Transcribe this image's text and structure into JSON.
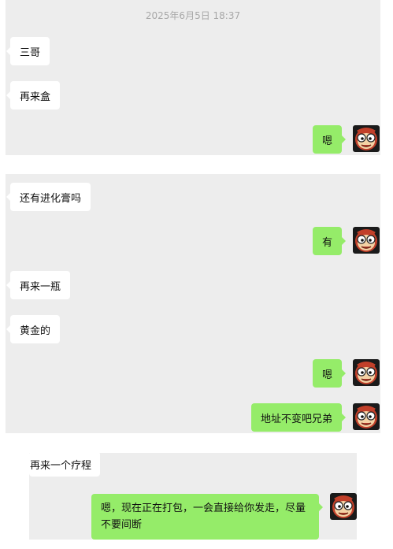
{
  "conversation": {
    "timestamp": "2025年6月5日 18:37",
    "messages": [
      {
        "side": "in",
        "text": "三哥"
      },
      {
        "side": "in",
        "text": "再来盒"
      },
      {
        "side": "out",
        "text": "嗯"
      },
      {
        "side": "in",
        "text": "还有进化膏吗"
      },
      {
        "side": "out",
        "text": "有"
      },
      {
        "side": "in",
        "text": "再来一瓶"
      },
      {
        "side": "in",
        "text": "黄金的"
      },
      {
        "side": "out",
        "text": "嗯"
      },
      {
        "side": "out",
        "text": "地址不变吧兄弟"
      },
      {
        "side": "in",
        "text": "再来一个疗程"
      },
      {
        "side": "out",
        "text": "嗯，现在正在打包，一会直接给你发走，尽量不要间断"
      }
    ]
  },
  "avatar": {
    "icon": "monkey-avatar-icon",
    "bg": "#1a1a1a",
    "face": "#f3d2a5",
    "hair": "#c2402a"
  },
  "colors": {
    "panel": "#ededed",
    "out_bubble": "#95ec69",
    "in_bubble": "#ffffff",
    "timestamp": "#a8a8a8"
  }
}
